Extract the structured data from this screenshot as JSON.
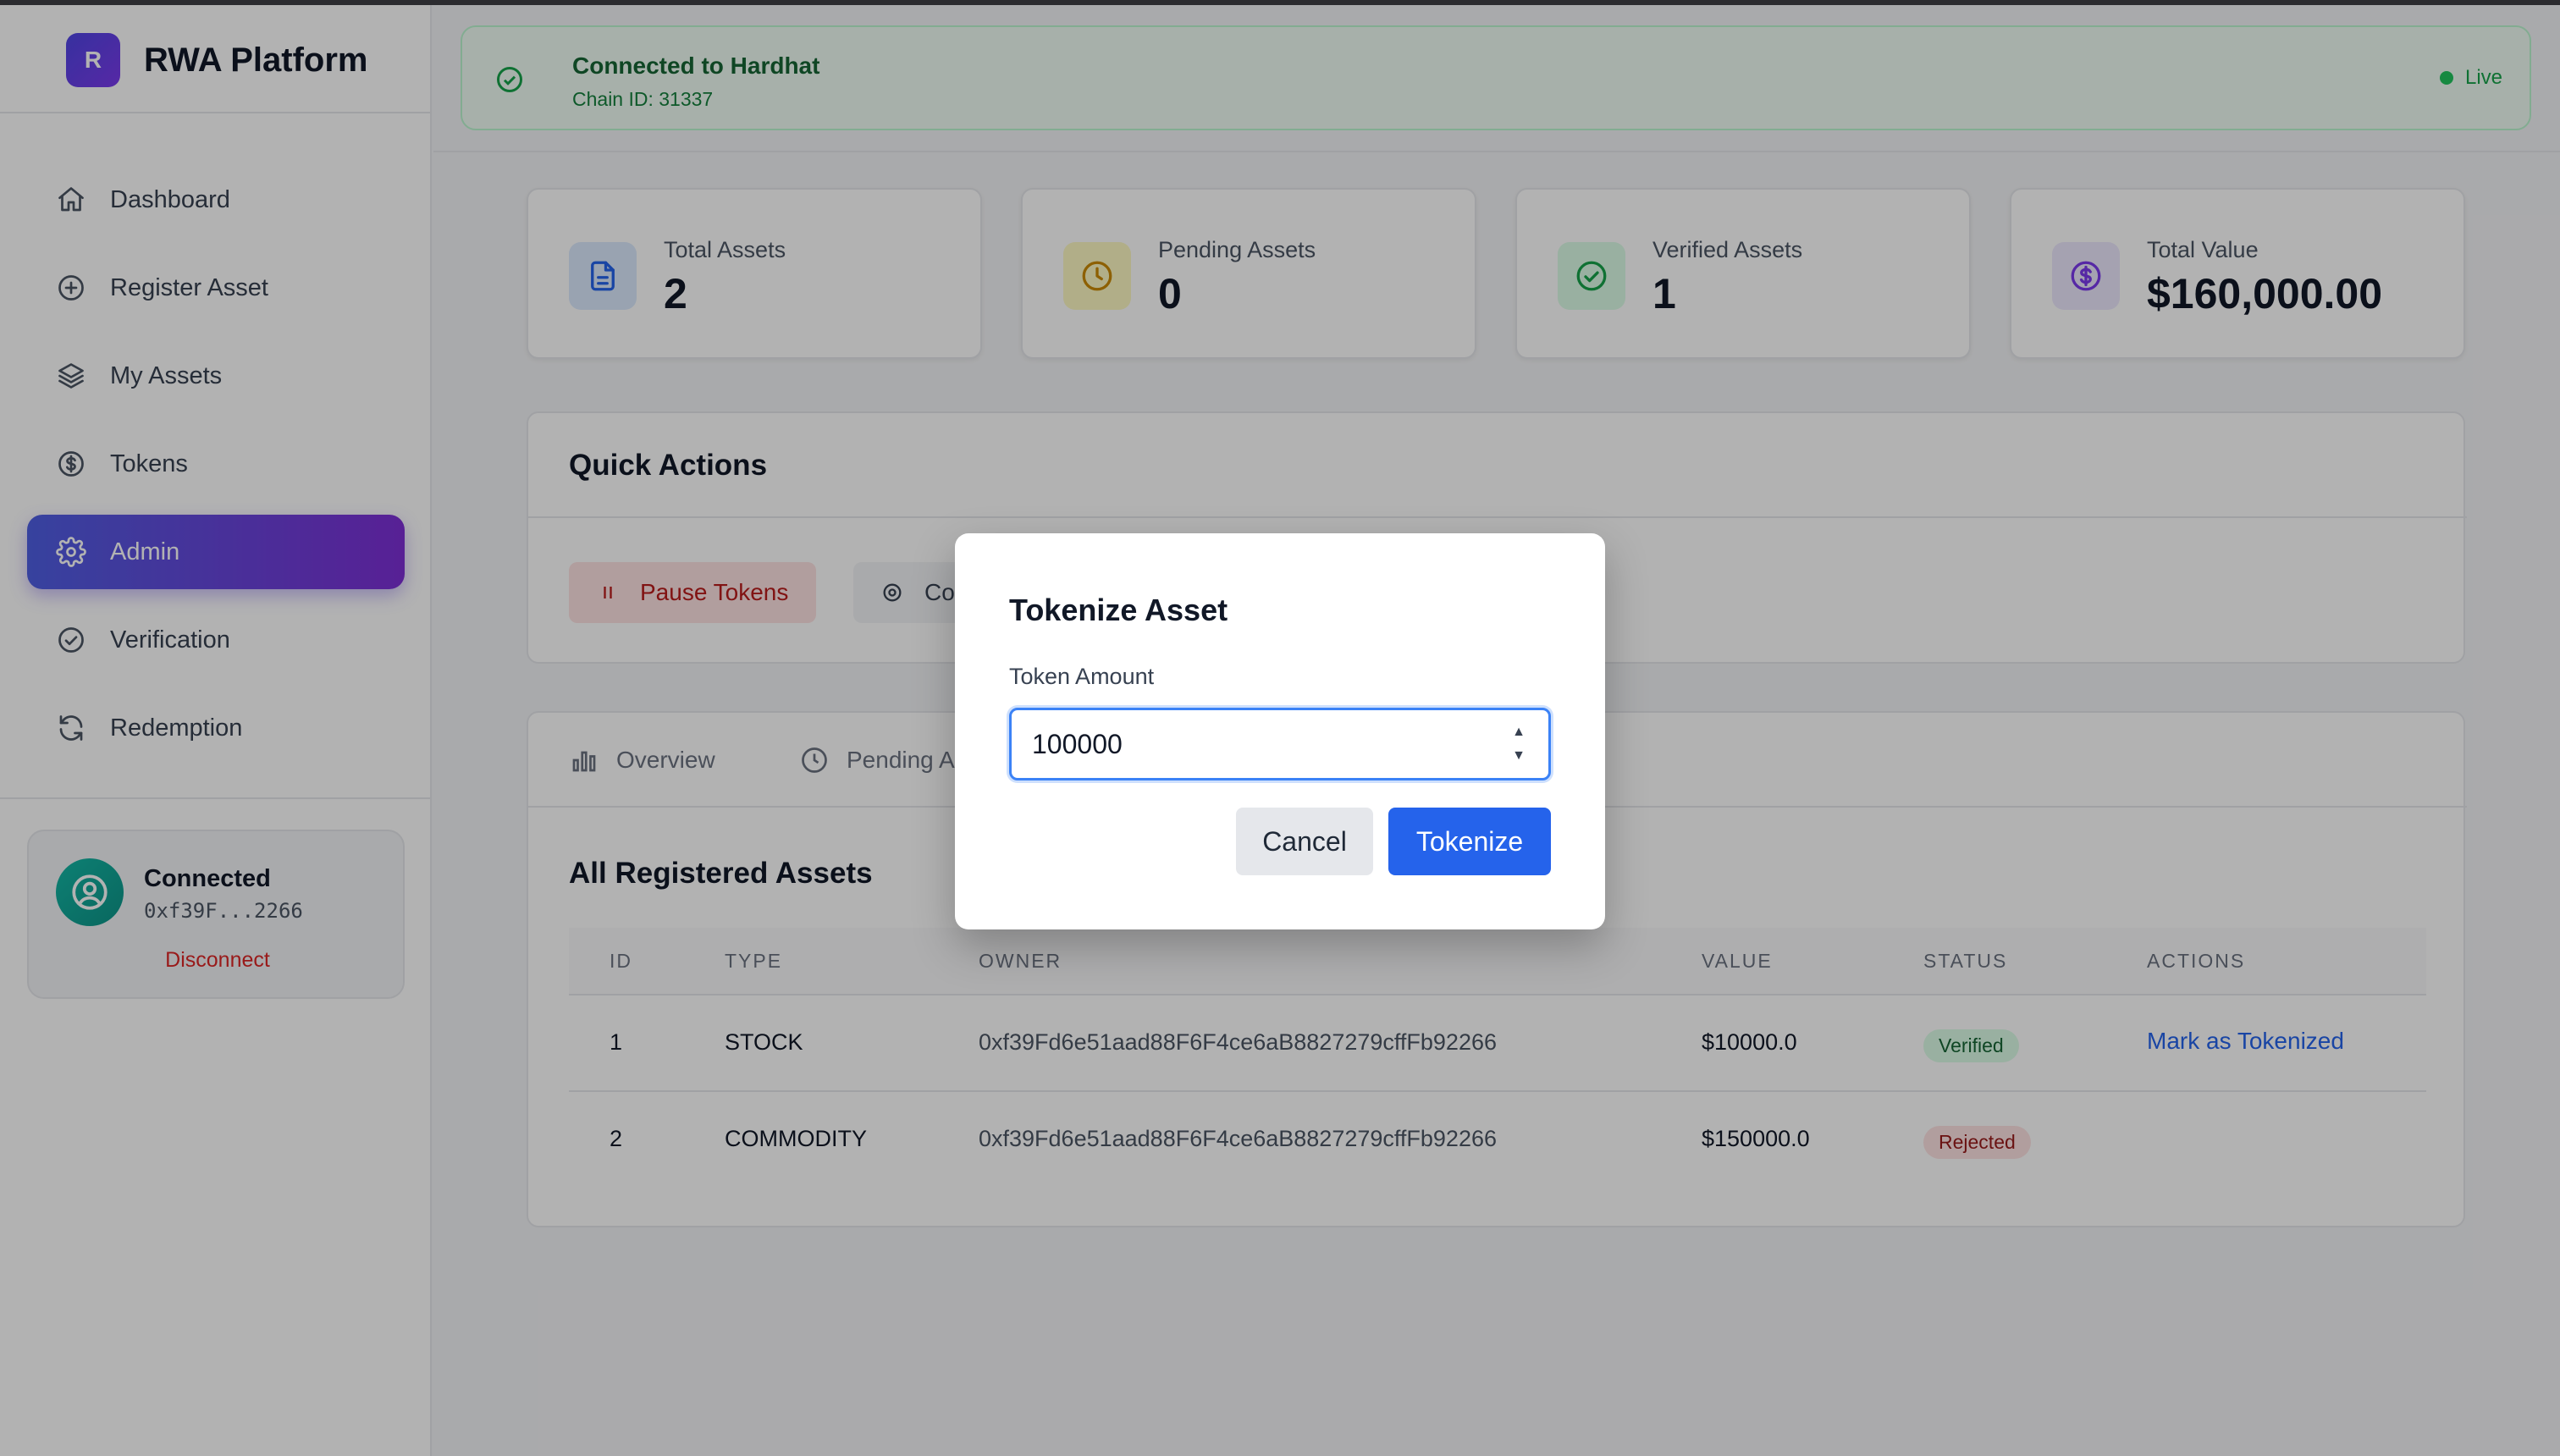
{
  "brand": {
    "logo_letter": "R",
    "name": "RWA Platform"
  },
  "nav": {
    "items": [
      {
        "label": "Dashboard",
        "icon": "home-icon"
      },
      {
        "label": "Register Asset",
        "icon": "plus-circle-icon"
      },
      {
        "label": "My Assets",
        "icon": "layers-icon"
      },
      {
        "label": "Tokens",
        "icon": "dollar-circle-icon"
      },
      {
        "label": "Admin",
        "icon": "gear-icon",
        "active": true
      },
      {
        "label": "Verification",
        "icon": "check-circle-icon"
      },
      {
        "label": "Redemption",
        "icon": "refresh-icon"
      }
    ]
  },
  "wallet": {
    "status": "Connected",
    "address": "0xf39F...2266",
    "disconnect_label": "Disconnect"
  },
  "banner": {
    "title": "Connected to Hardhat",
    "subtitle": "Chain ID: 31337",
    "live_label": "Live"
  },
  "stats": [
    {
      "label": "Total Assets",
      "value": "2",
      "icon": "document-icon",
      "color": "#2563eb",
      "bg": "#dbeafe"
    },
    {
      "label": "Pending Assets",
      "value": "0",
      "icon": "clock-icon",
      "color": "#ca8a04",
      "bg": "#fef9c3"
    },
    {
      "label": "Verified Assets",
      "value": "1",
      "icon": "check-circle-icon",
      "color": "#16a34a",
      "bg": "#dcfce7"
    },
    {
      "label": "Total Value",
      "value": "$160,000.00",
      "icon": "dollar-circle-icon",
      "color": "#7c3aed",
      "bg": "#ede9fe"
    }
  ],
  "quick_actions": {
    "title": "Quick Actions",
    "pause_label": "Pause Tokens",
    "config_label": "Con"
  },
  "tabs": [
    {
      "label": "Overview",
      "icon": "bar-chart-icon"
    },
    {
      "label": "Pending A",
      "icon": "clock-icon"
    }
  ],
  "assets_table": {
    "title": "All Registered Assets",
    "columns": [
      "ID",
      "TYPE",
      "OWNER",
      "VALUE",
      "STATUS",
      "ACTIONS"
    ],
    "rows": [
      {
        "id": "1",
        "type": "STOCK",
        "owner": "0xf39Fd6e51aad88F6F4ce6aB8827279cffFb92266",
        "value": "$10000.0",
        "status": "Verified",
        "action": "Mark as Tokenized"
      },
      {
        "id": "2",
        "type": "COMMODITY",
        "owner": "0xf39Fd6e51aad88F6F4ce6aB8827279cffFb92266",
        "value": "$150000.0",
        "status": "Rejected",
        "action": ""
      }
    ]
  },
  "modal": {
    "title": "Tokenize Asset",
    "field_label": "Token Amount",
    "field_value": "100000",
    "cancel_label": "Cancel",
    "confirm_label": "Tokenize"
  }
}
